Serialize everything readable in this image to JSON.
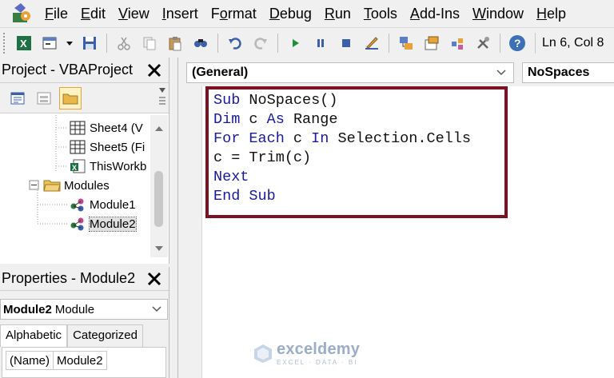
{
  "menubar": {
    "items": [
      "File",
      "Edit",
      "View",
      "Insert",
      "Format",
      "Debug",
      "Run",
      "Tools",
      "Add-Ins",
      "Window",
      "Help"
    ],
    "underline_index": [
      0,
      0,
      0,
      0,
      1,
      0,
      0,
      0,
      0,
      0,
      0
    ]
  },
  "toolbar": {
    "icons": [
      "excel-icon",
      "insert-userform-icon",
      "dropdown-arrow-icon",
      "save-icon",
      "cut-icon",
      "copy-icon",
      "paste-icon",
      "find-icon",
      "undo-icon",
      "redo-icon",
      "run-icon",
      "break-icon",
      "reset-icon",
      "design-mode-icon",
      "project-explorer-icon",
      "properties-window-icon",
      "object-browser-icon",
      "toolbox-icon",
      "help-icon"
    ],
    "cursor_position": "Ln 6, Col 8"
  },
  "project_pane": {
    "title": "Project - VBAProject",
    "tree": [
      {
        "label": "Sheet4 (V",
        "icon": "worksheet-icon"
      },
      {
        "label": "Sheet5 (Fi",
        "icon": "worksheet-icon"
      },
      {
        "label": "ThisWorkb",
        "icon": "workbook-icon"
      },
      {
        "label": "Modules",
        "icon": "folder-icon"
      },
      {
        "label": "Module1",
        "icon": "module-icon"
      },
      {
        "label": "Module2",
        "icon": "module-icon",
        "selected": true
      }
    ]
  },
  "properties_pane": {
    "title": "Properties - Module2",
    "object_name": "Module2",
    "object_type": "Module",
    "tabs": [
      "Alphabetic",
      "Categorized"
    ],
    "active_tab": "Alphabetic",
    "rows": [
      {
        "name": "(Name)",
        "value": "Module2"
      }
    ]
  },
  "code_window": {
    "object_combo": "(General)",
    "procedure_combo": "NoSpaces",
    "lines": [
      [
        {
          "t": "Sub",
          "k": true
        },
        {
          "t": " NoSpaces()",
          "k": false
        }
      ],
      [
        {
          "t": "Dim",
          "k": true
        },
        {
          "t": " c ",
          "k": false
        },
        {
          "t": "As",
          "k": true
        },
        {
          "t": " Range",
          "k": false
        }
      ],
      [
        {
          "t": "For Each",
          "k": true
        },
        {
          "t": " c ",
          "k": false
        },
        {
          "t": "In",
          "k": true
        },
        {
          "t": " Selection.Cells",
          "k": false
        }
      ],
      [
        {
          "t": "c = Trim(c)",
          "k": false
        }
      ],
      [
        {
          "t": "Next",
          "k": true
        }
      ],
      [
        {
          "t": "End Sub",
          "k": true
        }
      ]
    ],
    "highlight_color": "#7c1124"
  },
  "watermark": {
    "title": "exceldemy",
    "subtitle": "EXCEL · DATA · BI"
  }
}
